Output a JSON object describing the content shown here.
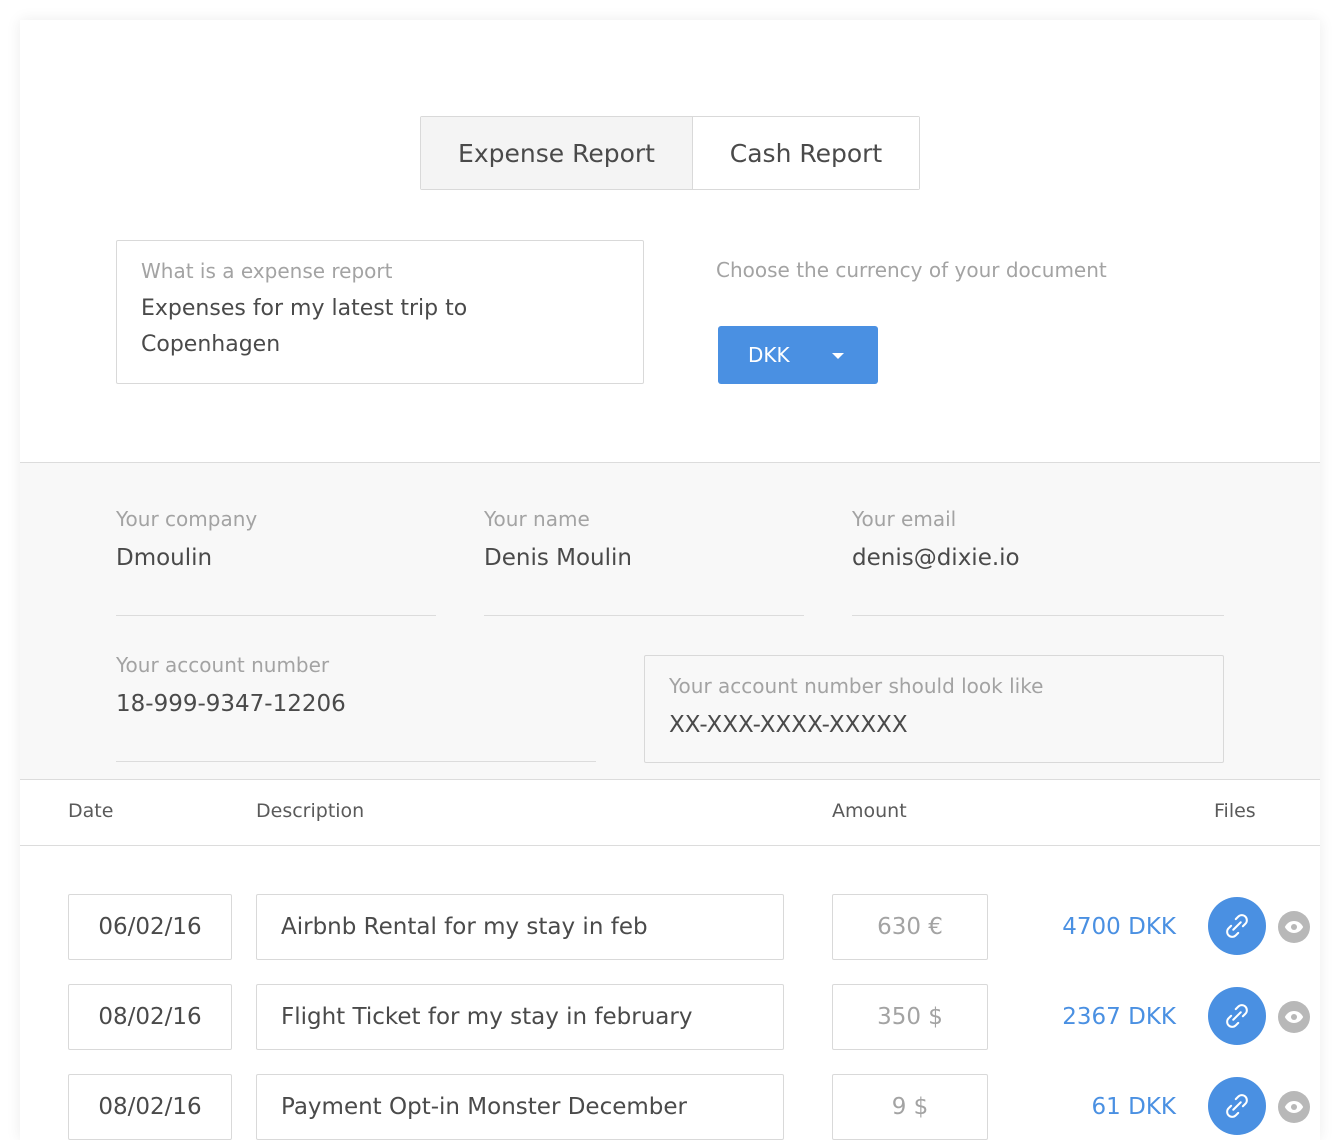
{
  "tabs": [
    {
      "label": "Expense Report",
      "active": true
    },
    {
      "label": "Cash Report",
      "active": false
    }
  ],
  "report": {
    "label": "What is a expense report",
    "value": "Expenses for my latest trip to Copenhagen"
  },
  "currency": {
    "label": "Choose the currency of your document",
    "selected": "DKK",
    "accent_color": "#4a90e2"
  },
  "info": {
    "company": {
      "label": "Your company",
      "value": "Dmoulin"
    },
    "name": {
      "label": "Your name",
      "value": "Denis Moulin"
    },
    "email": {
      "label": "Your email",
      "value": "denis@dixie.io"
    },
    "account": {
      "label": "Your account number",
      "value": "18-999-9347-12206"
    },
    "account_hint": {
      "label": "Your account number should look like",
      "value": "XX-XXX-XXXX-XXXXX"
    }
  },
  "table": {
    "headers": {
      "date": "Date",
      "description": "Description",
      "amount": "Amount",
      "files": "Files"
    },
    "rows": [
      {
        "date": "06/02/16",
        "description": "Airbnb Rental for my stay in feb",
        "amount": "630 €",
        "converted": "4700 DKK",
        "attach_icon": "paperclip-icon",
        "view_icon": "eye-icon"
      },
      {
        "date": "08/02/16",
        "description": "Flight Ticket for my stay in february",
        "amount": "350 $",
        "converted": "2367 DKK",
        "attach_icon": "paperclip-icon",
        "view_icon": "eye-icon"
      },
      {
        "date": "08/02/16",
        "description": "Payment Opt-in Monster December",
        "amount": "9 $",
        "converted": "61 DKK",
        "attach_icon": "paperclip-icon",
        "view_icon": "eye-icon"
      }
    ]
  }
}
